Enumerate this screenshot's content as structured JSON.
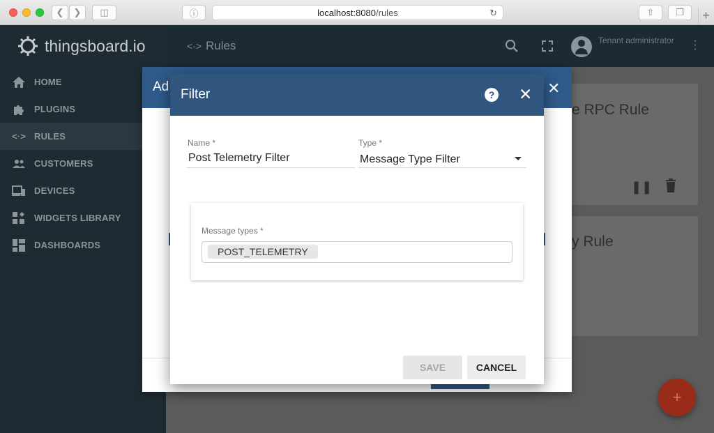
{
  "browser": {
    "url_host": "localhost:8080",
    "url_path": "/rules"
  },
  "app": {
    "logo_text": "thingsboard.io",
    "page_title": "Rules",
    "user_role": "Tenant administrator"
  },
  "sidebar": {
    "items": [
      {
        "label": "HOME",
        "icon": "home-icon"
      },
      {
        "label": "PLUGINS",
        "icon": "puzzle-icon"
      },
      {
        "label": "RULES",
        "icon": "code-arrows-icon"
      },
      {
        "label": "CUSTOMERS",
        "icon": "people-icon"
      },
      {
        "label": "DEVICES",
        "icon": "devices-icon"
      },
      {
        "label": "WIDGETS LIBRARY",
        "icon": "widgets-icon"
      },
      {
        "label": "DASHBOARDS",
        "icon": "dashboard-icon"
      }
    ]
  },
  "background": {
    "dialog_title_fragment": "Ad",
    "card1_title_fragment": "e RPC Rule",
    "card2_title_fragment": "y Rule"
  },
  "filter_dialog": {
    "title": "Filter",
    "name_label": "Name *",
    "name_value": "Post Telemetry Filter",
    "type_label": "Type *",
    "type_value": "Message Type Filter",
    "message_types_label": "Message types *",
    "message_types": [
      "POST_TELEMETRY"
    ],
    "save_label": "SAVE",
    "cancel_label": "CANCEL"
  },
  "colors": {
    "header_blue": "#305680",
    "sidebar_bg": "#1f2b33",
    "fab_red": "#992c19"
  }
}
